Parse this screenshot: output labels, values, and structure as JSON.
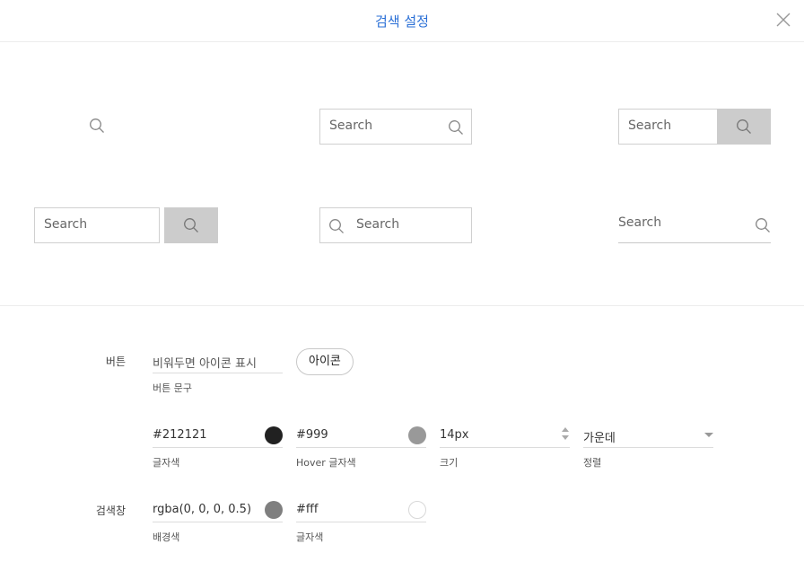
{
  "dialog": {
    "title": "검색 설정"
  },
  "preview": {
    "placeholder": "Search"
  },
  "button_section": {
    "label": "버튼",
    "text_field_value": "비워두면 아이콘 표시",
    "text_field_caption": "버튼 문구",
    "icon_toggle_label": "아이콘",
    "text_color": {
      "value": "#212121",
      "caption": "글자색",
      "swatch": "#212121"
    },
    "hover_color": {
      "value": "#999",
      "caption": "Hover 글자색",
      "swatch": "#999999"
    },
    "size": {
      "value": "14px",
      "caption": "크기"
    },
    "align": {
      "value": "가운데",
      "caption": "정렬"
    }
  },
  "searchbox_section": {
    "label": "검색창",
    "bg_color": {
      "value": "rgba(0, 0, 0, 0.5)",
      "caption": "배경색",
      "swatch": "#7f7f7f"
    },
    "text_color": {
      "value": "#fff",
      "caption": "글자색",
      "swatch": "#ffffff"
    }
  }
}
